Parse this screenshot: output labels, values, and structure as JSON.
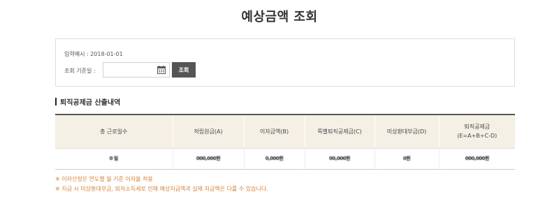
{
  "page": {
    "title": "예상금액 조회"
  },
  "search": {
    "example": "입력예시 : 2018-01-01",
    "date_label": "조회 기준일 :",
    "date_value": "",
    "button_label": "조회",
    "icon": "calendar-icon"
  },
  "section": {
    "title": "퇴직공제금 산출내역"
  },
  "table": {
    "headers": [
      "총 근로일수",
      "적립원금(A)",
      "이자금액(B)",
      "특별퇴직공제금(C)",
      "미상환대부금(D)",
      "퇴직공제금",
      "(E=A+B+C-D)"
    ],
    "row": [
      "0 일",
      "000,000원",
      "0,000원",
      "00,000원",
      "0원",
      "000,000원"
    ]
  },
  "notes": [
    "※ 이자산정은 연도별 월 기준 이자율 적용",
    "※ 지급 시 미상환대부금, 퇴직소득세로 인해 예상지급액과 실제 지급액은 다를 수 있습니다."
  ],
  "colors": {
    "header_bg": "#f5f0e6",
    "button_bg": "#555555",
    "note_color": "#d4823a"
  }
}
